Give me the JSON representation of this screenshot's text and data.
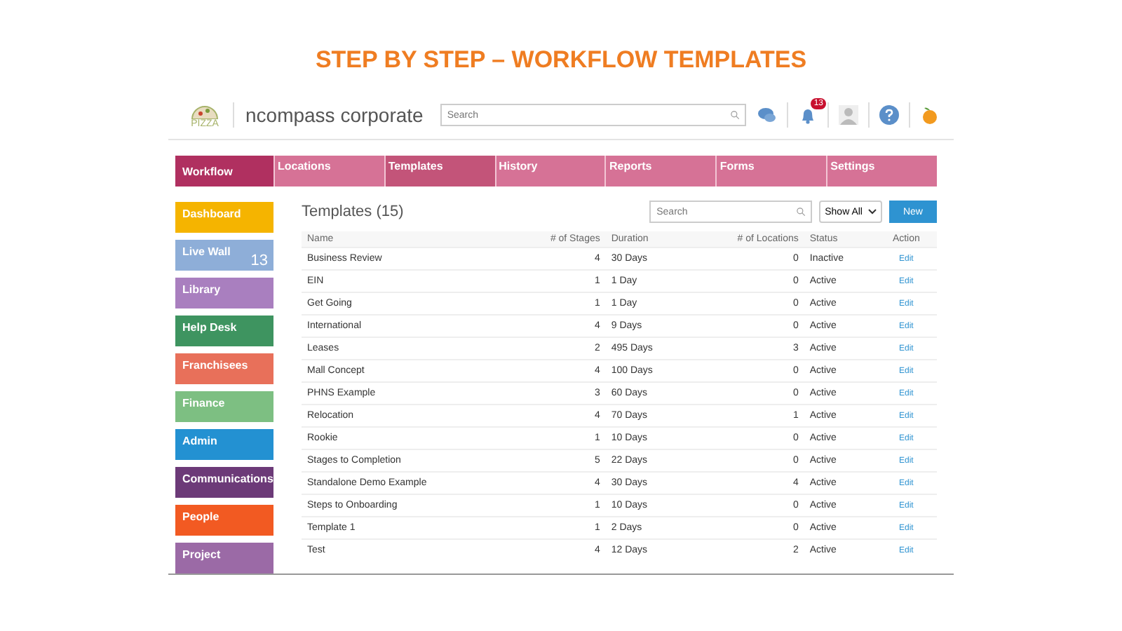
{
  "slide_title": "STEP BY STEP – WORKFLOW TEMPLATES",
  "header": {
    "logo_text": "PIZZA",
    "company": "ncompass corporate",
    "search": {
      "placeholder": "Search"
    },
    "notification_count": "13"
  },
  "module": "Workflow",
  "tabs": [
    {
      "label": "Locations",
      "selected": false
    },
    {
      "label": "Templates",
      "selected": true
    },
    {
      "label": "History",
      "selected": false
    },
    {
      "label": "Reports",
      "selected": false
    },
    {
      "label": "Forms",
      "selected": false
    },
    {
      "label": "Settings",
      "selected": false
    }
  ],
  "sidebar": {
    "items": [
      {
        "label": "Dashboard",
        "color": "#f5b400"
      },
      {
        "label": "Live Wall",
        "color": "#8eaed8",
        "count": "13"
      },
      {
        "label": "Library",
        "color": "#a97fbf"
      },
      {
        "label": "Help Desk",
        "color": "#3e9460"
      },
      {
        "label": "Franchisees",
        "color": "#e8705a"
      },
      {
        "label": "Finance",
        "color": "#7dbf82"
      },
      {
        "label": "Admin",
        "color": "#2391d2"
      },
      {
        "label": "Communications",
        "color": "#6c3a78"
      },
      {
        "label": "People",
        "color": "#f25a22"
      },
      {
        "label": "Project",
        "color": "#9b6aa6"
      }
    ]
  },
  "content": {
    "title": "Templates (15)",
    "search": {
      "placeholder": "Search"
    },
    "filter": "Show All",
    "new_button": "New",
    "table": {
      "columns": [
        "Name",
        "# of Stages",
        "Duration",
        "# of Locations",
        "Status",
        "Action"
      ],
      "rows": [
        [
          "Business Review",
          "4",
          "30 Days",
          "0",
          "Inactive",
          "Edit"
        ],
        [
          "EIN",
          "1",
          "1 Day",
          "0",
          "Active",
          "Edit"
        ],
        [
          "Get Going",
          "1",
          "1 Day",
          "0",
          "Active",
          "Edit"
        ],
        [
          "International",
          "4",
          "9 Days",
          "0",
          "Active",
          "Edit"
        ],
        [
          "Leases",
          "2",
          "495 Days",
          "3",
          "Active",
          "Edit"
        ],
        [
          "Mall Concept",
          "4",
          "100 Days",
          "0",
          "Active",
          "Edit"
        ],
        [
          "PHNS Example",
          "3",
          "60 Days",
          "0",
          "Active",
          "Edit"
        ],
        [
          "Relocation",
          "4",
          "70 Days",
          "1",
          "Active",
          "Edit"
        ],
        [
          "Rookie",
          "1",
          "10 Days",
          "0",
          "Active",
          "Edit"
        ],
        [
          "Stages to Completion",
          "5",
          "22 Days",
          "0",
          "Active",
          "Edit"
        ],
        [
          "Standalone Demo Example",
          "4",
          "30 Days",
          "4",
          "Active",
          "Edit"
        ],
        [
          "Steps to Onboarding",
          "1",
          "10 Days",
          "0",
          "Active",
          "Edit"
        ],
        [
          "Template 1",
          "1",
          "2 Days",
          "0",
          "Active",
          "Edit"
        ],
        [
          "Test",
          "4",
          "12 Days",
          "2",
          "Active",
          "Edit"
        ]
      ]
    }
  }
}
